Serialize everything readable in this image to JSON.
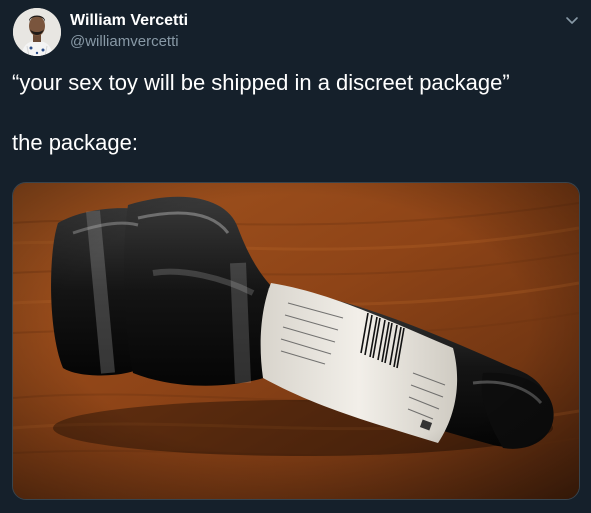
{
  "tweet": {
    "author": {
      "display_name": "William Vercetti",
      "handle": "@williamvercetti",
      "avatar_icon": "profile-photo"
    },
    "menu_icon": "chevron-down-icon",
    "text_lines": [
      "“your sex toy will be shipped in a discreet package”",
      "the package:"
    ],
    "media": {
      "icon": "photo",
      "shipping_label_text": "BARCODE LABEL"
    }
  },
  "colors": {
    "background": "#15202b",
    "text_primary": "#ffffff",
    "text_secondary": "#8899a6",
    "border": "#38444d"
  }
}
